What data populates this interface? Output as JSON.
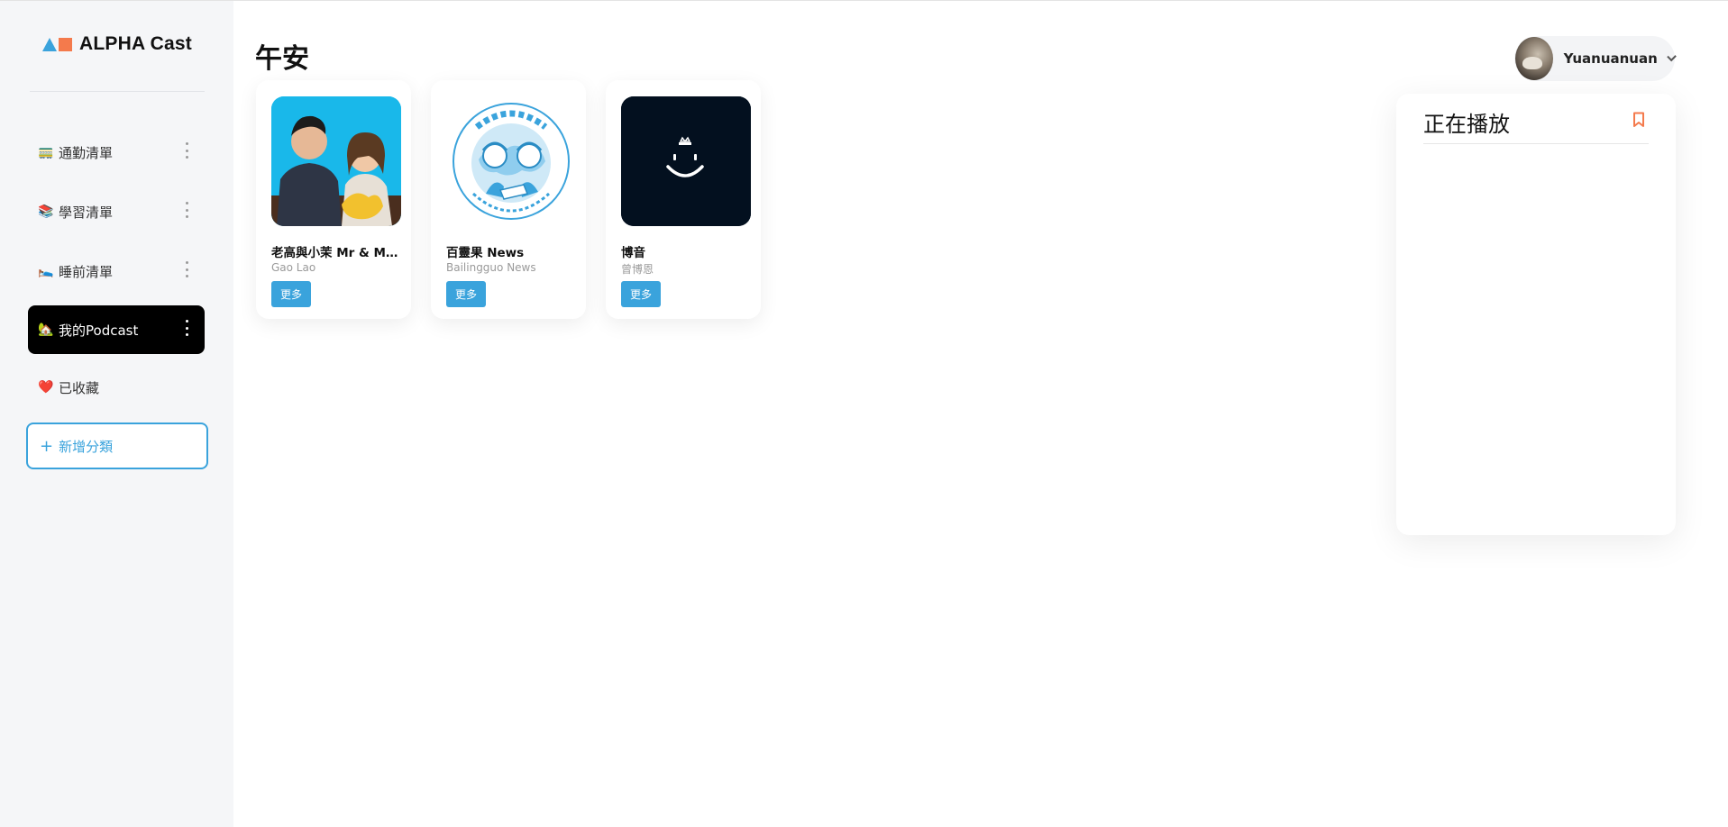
{
  "app": {
    "brand": "ALPHA Cast",
    "brand_colors": {
      "triangle": "#3aa3dc",
      "square": "#f47a4c"
    }
  },
  "sidebar": {
    "items": [
      {
        "emoji": "🚃",
        "icon": "train-icon",
        "label": "通勤清單",
        "active": false
      },
      {
        "emoji": "📚",
        "icon": "books-icon",
        "label": "學習清單",
        "active": false
      },
      {
        "emoji": "🛌",
        "icon": "bed-icon",
        "label": "睡前清單",
        "active": false
      },
      {
        "emoji": "🏡",
        "icon": "house-icon",
        "label": "我的Podcast",
        "active": true
      },
      {
        "emoji": "❤️",
        "icon": "heart-icon",
        "label": "已收藏",
        "active": false
      }
    ],
    "add_category_label": "新增分類",
    "add_category_symbol": "+"
  },
  "header": {
    "greeting": "午安",
    "user_name": "Yuanuanuan"
  },
  "podcasts": [
    {
      "title": "老高與小茉 Mr & Mrs Gao",
      "author": "Gao Lao",
      "button": "更多"
    },
    {
      "title": "百靈果 News",
      "author": "Bailingguo News",
      "button": "更多"
    },
    {
      "title": "博音",
      "author": "曾博恩",
      "button": "更多"
    }
  ],
  "now_playing": {
    "title": "正在播放",
    "bookmark_icon": "bookmark-icon"
  },
  "colors": {
    "accent": "#3aa3dc",
    "bookmark": "#f47a4c",
    "active_nav_bg": "#000000",
    "sidebar_bg": "#f5f6f8"
  }
}
